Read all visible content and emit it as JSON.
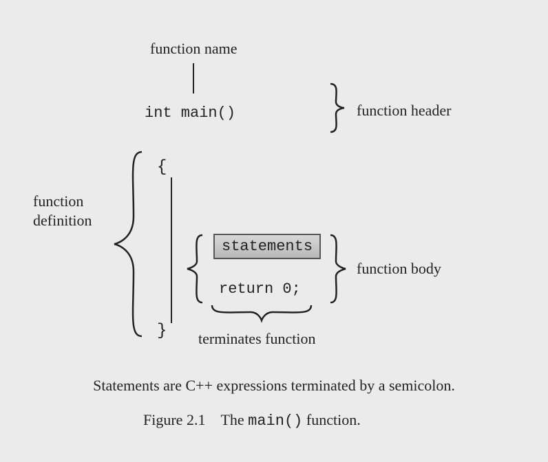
{
  "labels": {
    "function_name": "function name",
    "function_header": "function header",
    "function_definition_l1": "function",
    "function_definition_l2": "definition",
    "function_body": "function body",
    "terminates_function": "terminates function"
  },
  "code": {
    "int_main": "int main()",
    "open_brace": "{",
    "statements": "statements",
    "return0": "return 0;",
    "close_brace": "}"
  },
  "caption": "Statements are C++ expressions terminated by a semicolon.",
  "figure": {
    "prefix": "Figure 2.1 The ",
    "code": "main()",
    "suffix": " function."
  }
}
